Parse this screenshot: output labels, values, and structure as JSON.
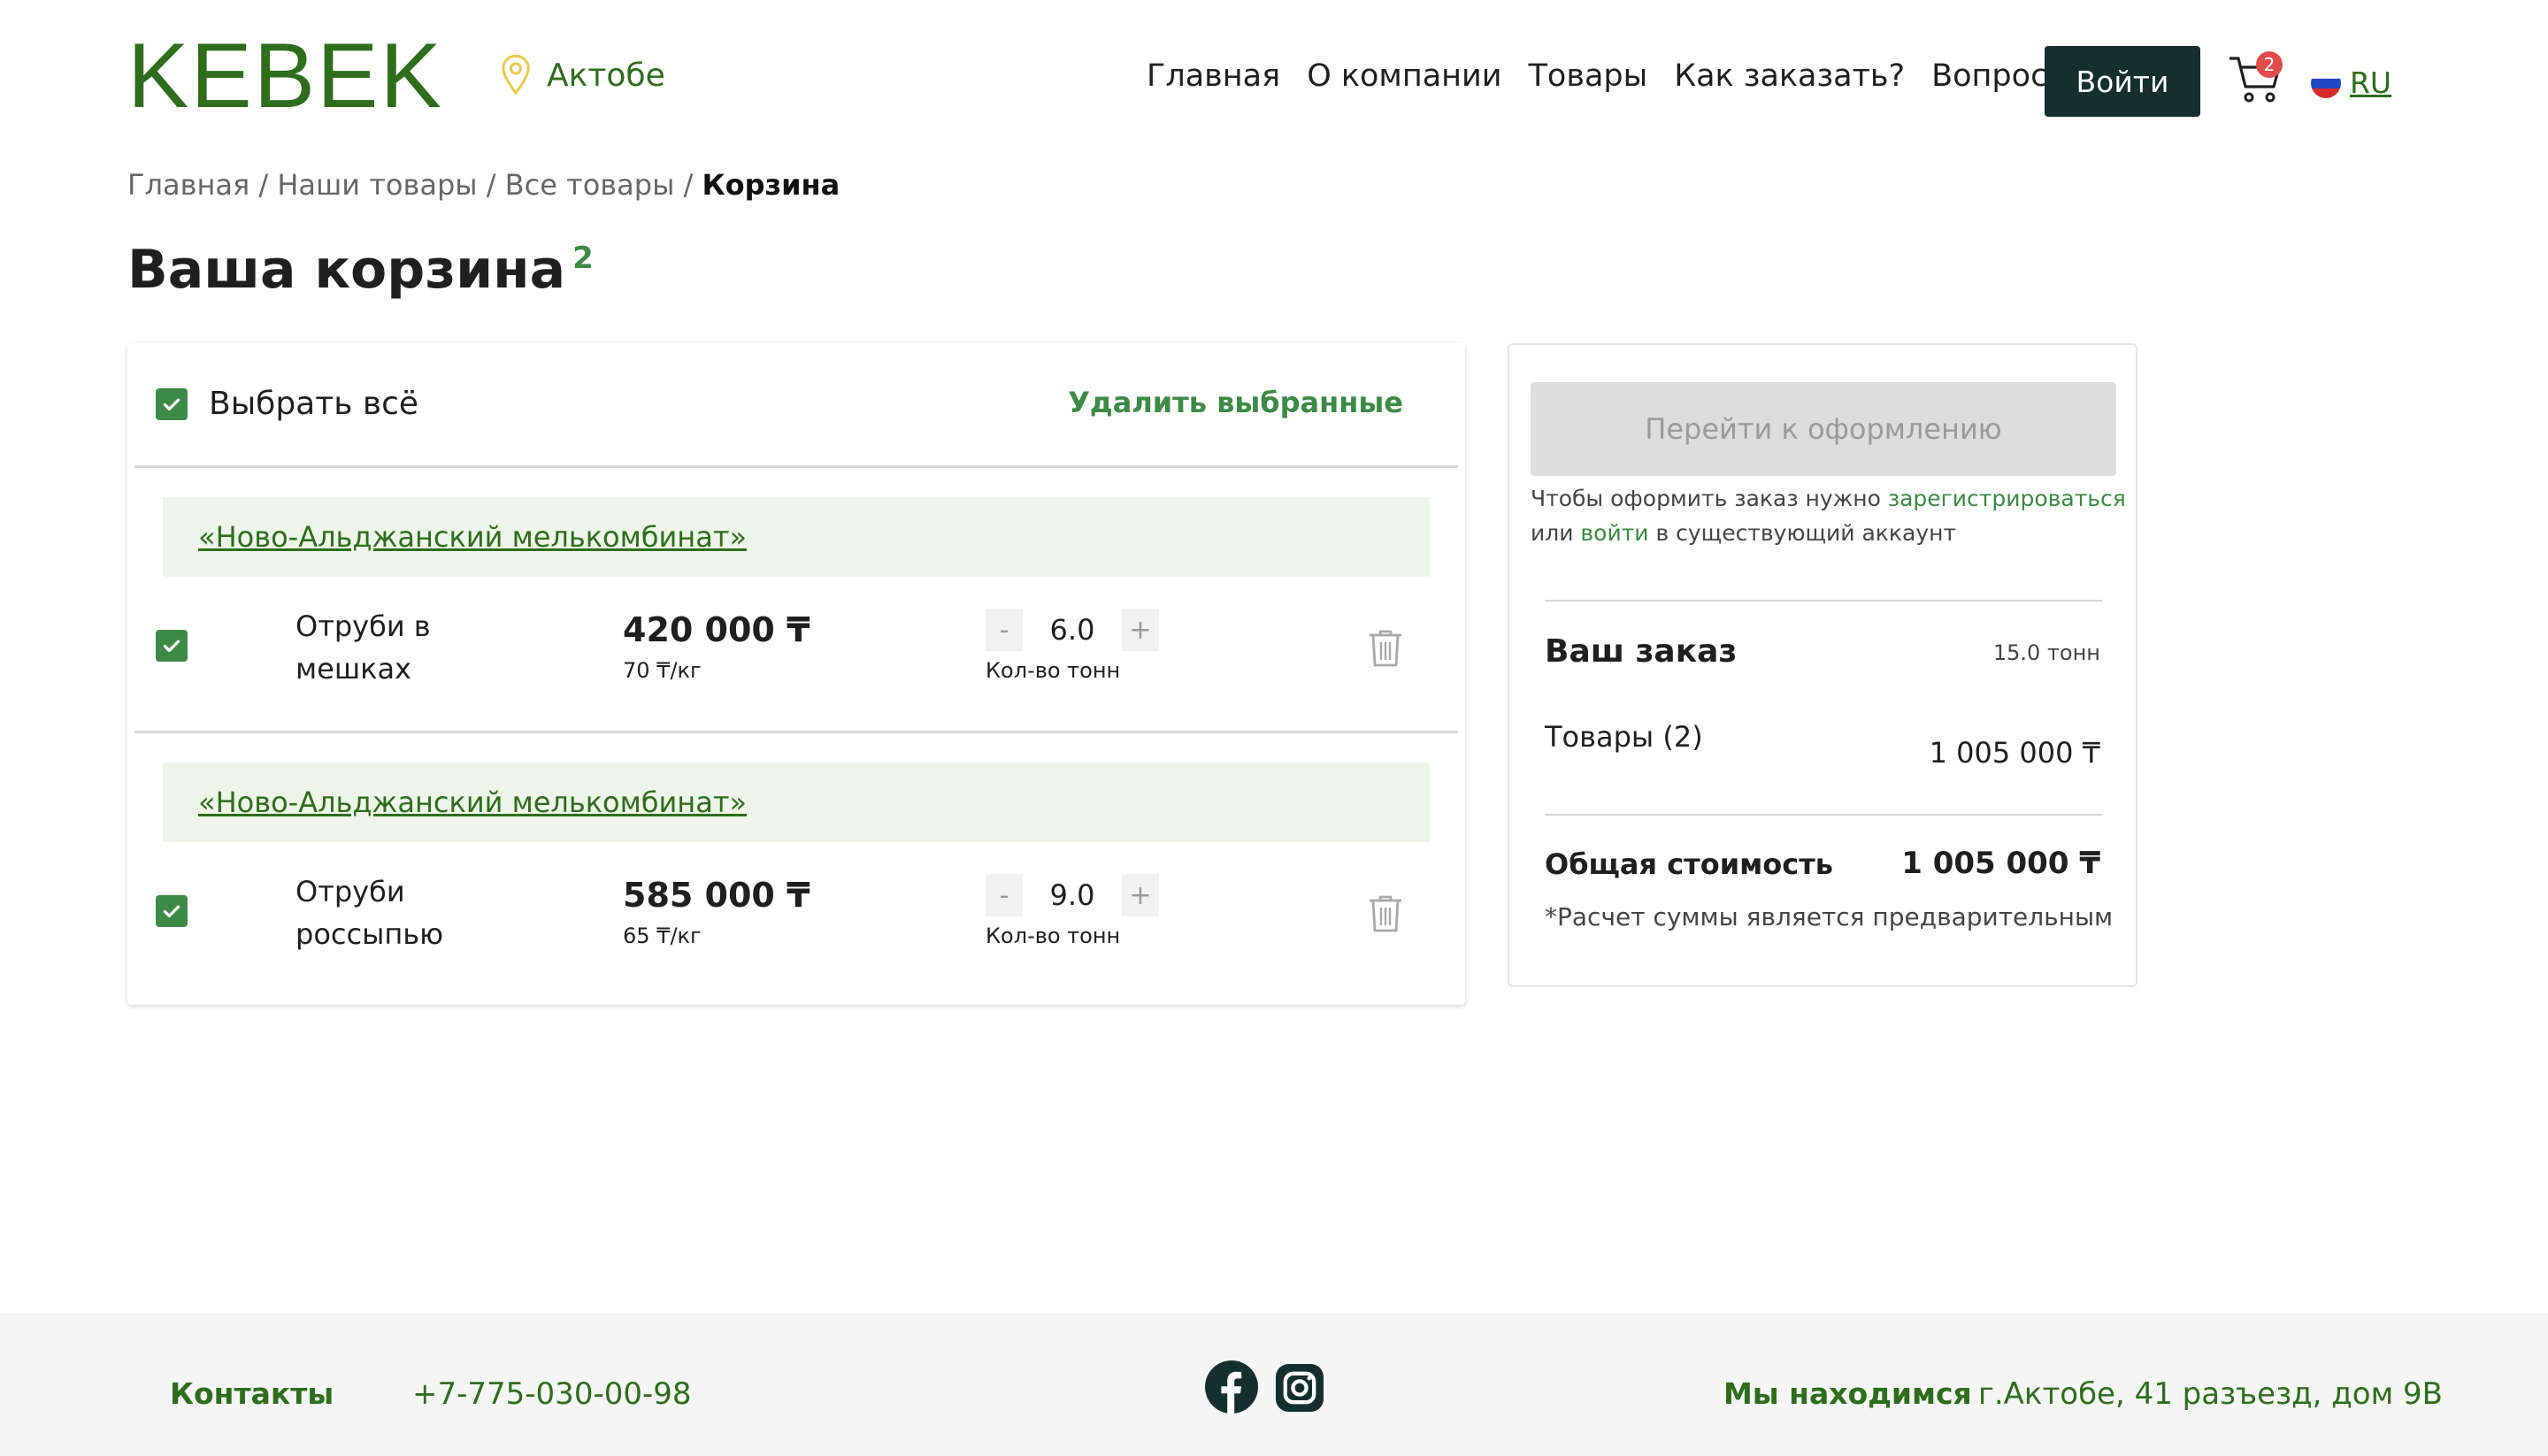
{
  "header": {
    "logo": "KEBEK",
    "city": "Актобе",
    "nav": [
      "Главная",
      "О компании",
      "Товары",
      "Как заказать?",
      "Вопросы"
    ],
    "login_label": "Войти",
    "cart_count": "2",
    "lang": "RU"
  },
  "breadcrumb": {
    "items": [
      "Главная",
      "Наши товары",
      "Все товары"
    ],
    "separator": " / ",
    "current": "Корзина"
  },
  "page": {
    "title": "Ваша корзина",
    "count": "2"
  },
  "cart": {
    "select_all_label": "Выбрать всё",
    "delete_selected_label": "Удалить выбранные",
    "items": [
      {
        "vendor": "«Ново-Альджанский мелькомбинат»",
        "name": "Отруби в мешках",
        "price": "420 000 ₸",
        "unit_price": "70 ₸/кг",
        "qty": "6.0",
        "qty_label": "Кол-во тонн",
        "minus": "-",
        "plus": "+",
        "checked": true
      },
      {
        "vendor": "«Ново-Альджанский мелькомбинат»",
        "name": "Отруби россыпью",
        "price": "585 000 ₸",
        "unit_price": "65 ₸/кг",
        "qty": "9.0",
        "qty_label": "Кол-во тонн",
        "minus": "-",
        "plus": "+",
        "checked": true
      }
    ]
  },
  "summary": {
    "checkout_label": "Перейти к оформлению",
    "note_prefix": "Чтобы оформить заказ нужно ",
    "register_link": "зарегистрироваться",
    "note_middle": " или ",
    "login_link": "войти",
    "note_suffix": " в существующий аккаунт",
    "order_title": "Ваш заказ",
    "order_weight": "15.0 тонн",
    "goods_label": "Товары (2)",
    "goods_sum": "1 005 000 ₸",
    "total_label": "Общая стоимость",
    "total_sum": "1 005 000 ₸",
    "prelim_note": "*Расчет суммы является предварительным"
  },
  "footer": {
    "contacts_label": "Контакты",
    "phone": "+7-775-030-00-98",
    "location_label": "Мы находимся",
    "address": "г.Актобе, 41 разъезд, дом 9В"
  },
  "colors": {
    "brand_green": "#2e6d1c",
    "accent_green": "#3c8a45",
    "dark_button": "#15302c",
    "badge_red": "#e34b4b",
    "vendor_bg": "#eef4ea"
  },
  "icons": [
    "map-pin-icon",
    "cart-icon",
    "flag-ru-icon",
    "checkbox-icon",
    "trash-icon",
    "facebook-icon",
    "instagram-icon"
  ]
}
